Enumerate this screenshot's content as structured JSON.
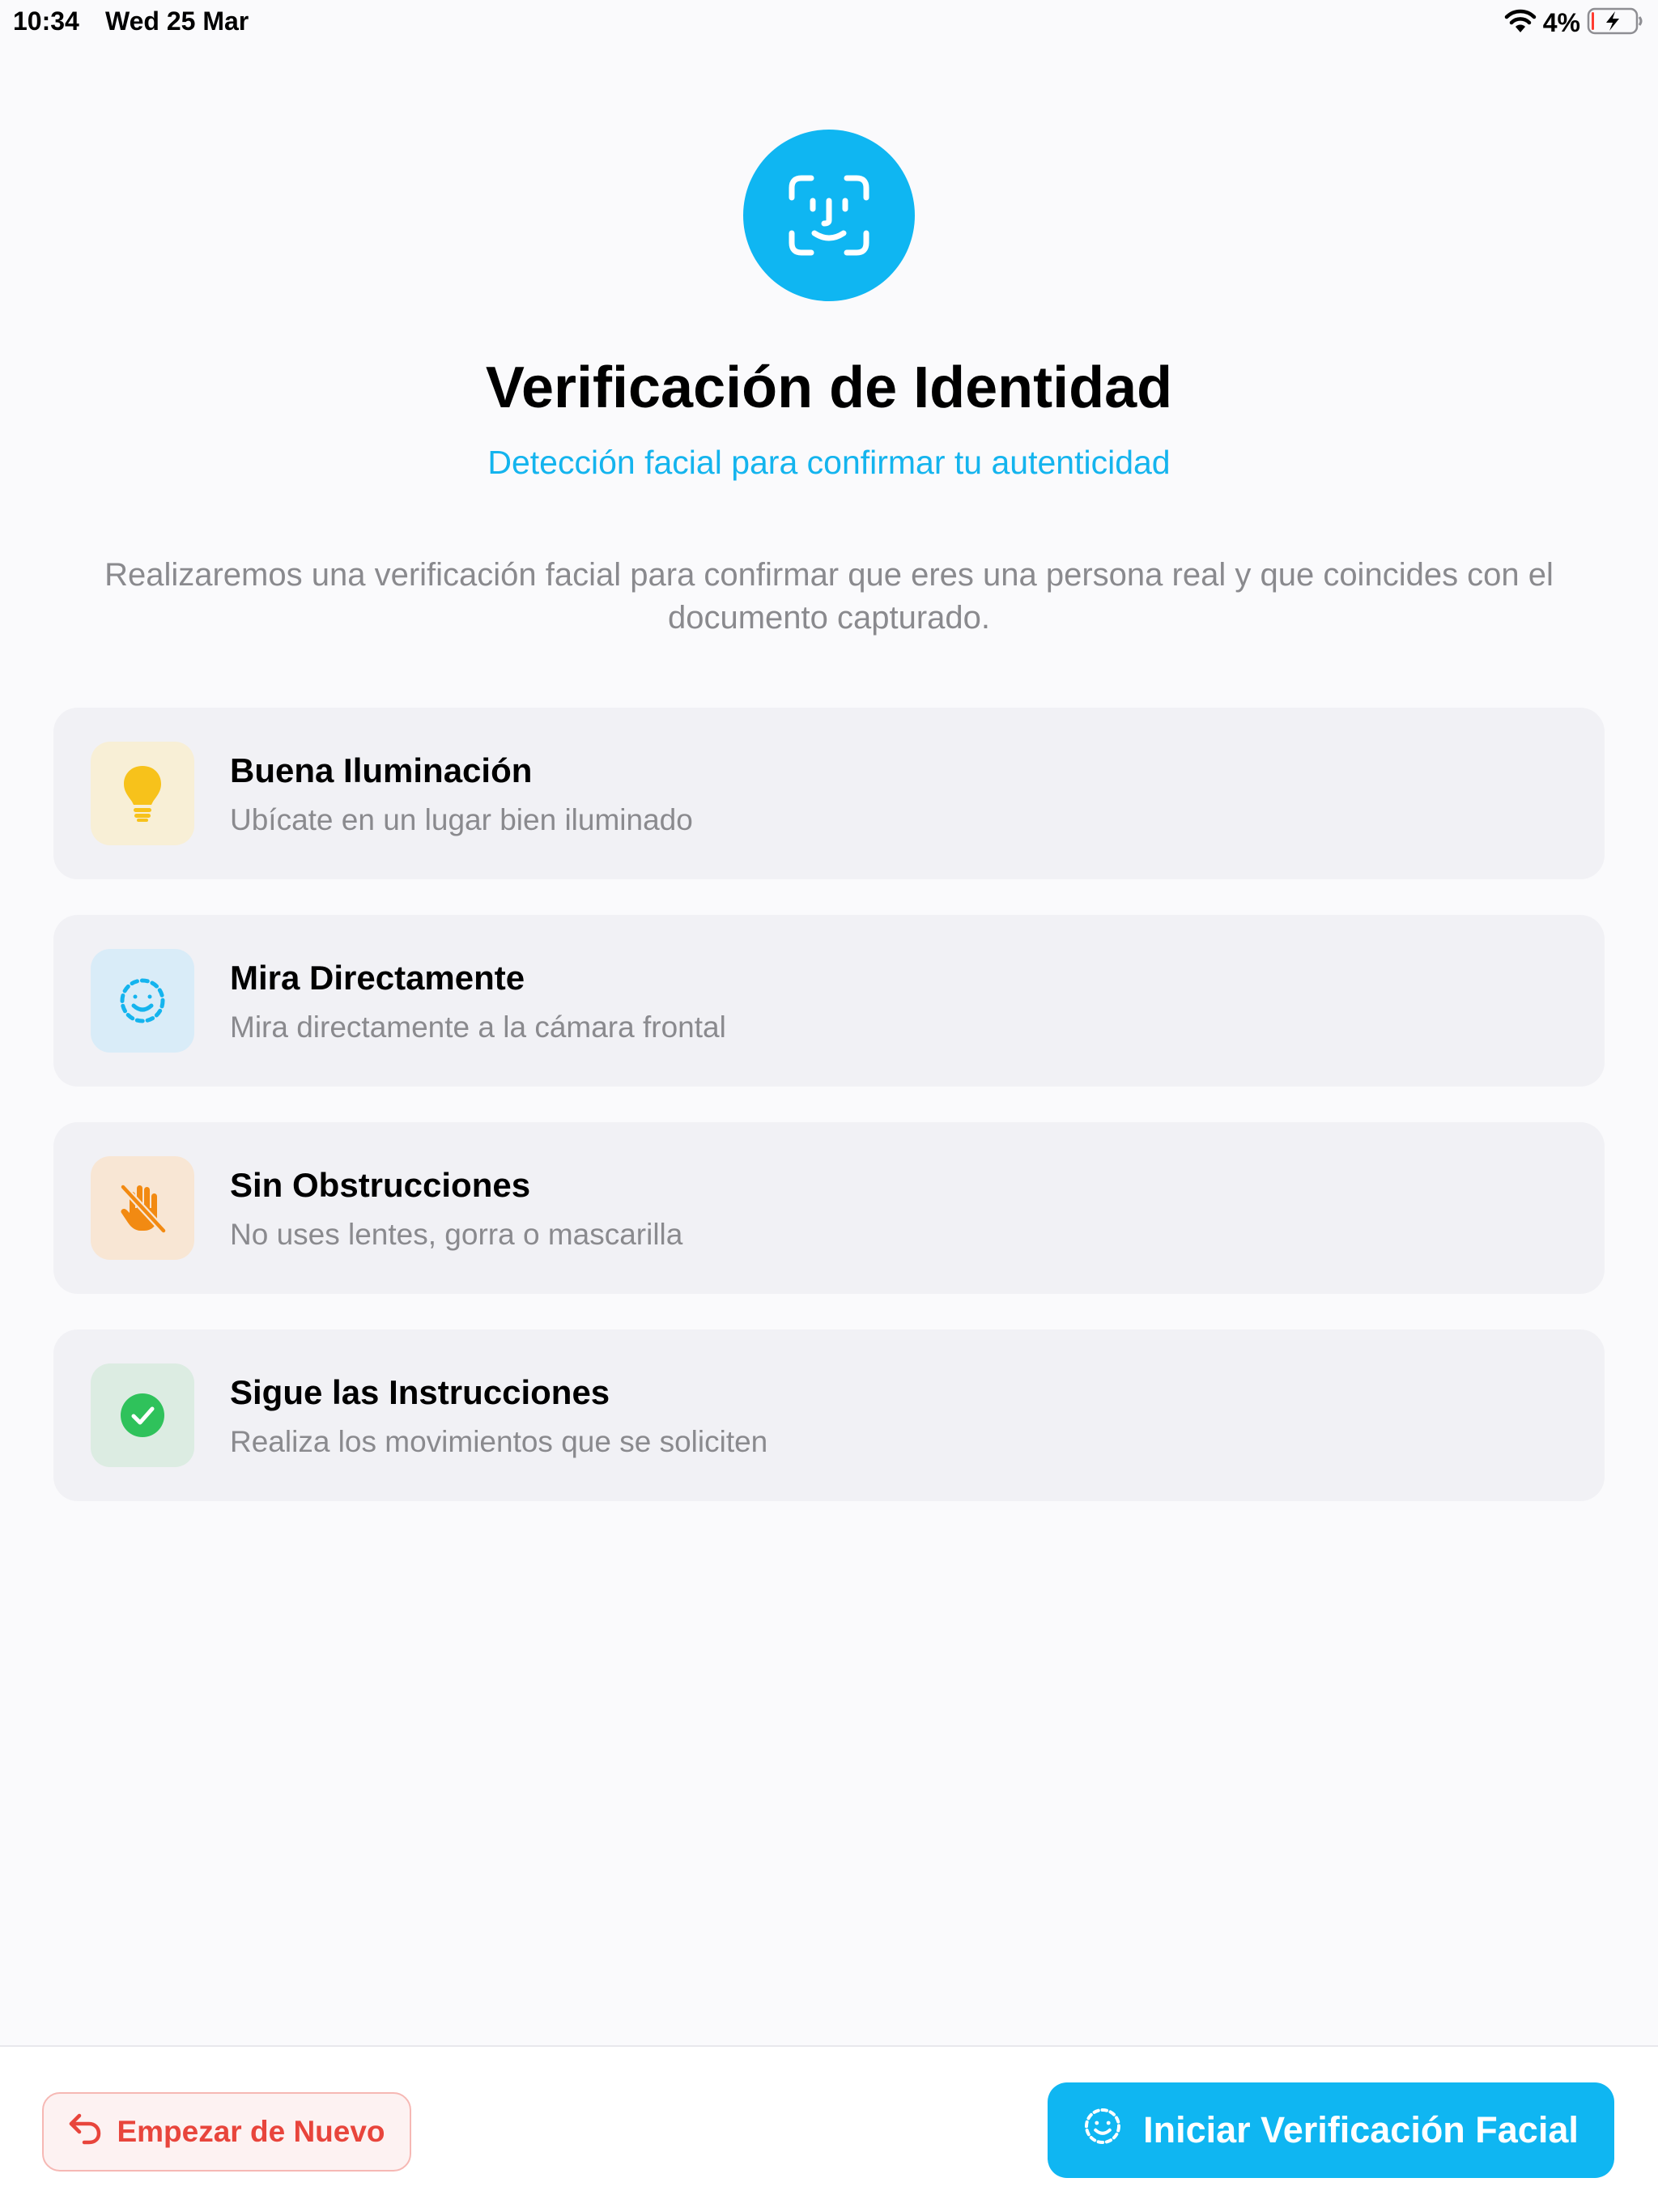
{
  "status_bar": {
    "time": "10:34",
    "date": "Wed 25 Mar",
    "battery_percent": "4%",
    "battery_level": 0.04,
    "charging": true
  },
  "header": {
    "icon": "face-id-icon",
    "title": "Verificación de Identidad",
    "subtitle": "Detección facial para confirmar tu autenticidad"
  },
  "description": "Realizaremos una verificación facial para confirmar que eres una persona real y que coincides con el documento capturado.",
  "tips": [
    {
      "icon": "lightbulb-icon",
      "title": "Buena Iluminación",
      "description": "Ubícate en un lugar bien iluminado",
      "accent": "#f7c21b"
    },
    {
      "icon": "face-dashed-icon",
      "title": "Mira Directamente",
      "description": "Mira directamente a la cámara frontal",
      "accent": "#14b4ee"
    },
    {
      "icon": "hand-slash-icon",
      "title": "Sin Obstrucciones",
      "description": "No uses lentes, gorra o mascarilla",
      "accent": "#f28a12"
    },
    {
      "icon": "checkmark-circle-icon",
      "title": "Sigue las Instrucciones",
      "description": "Realiza los movimientos que se soliciten",
      "accent": "#2fc25b"
    }
  ],
  "actions": {
    "restart_label": "Empezar de Nuevo",
    "restart_icon": "undo-arrow-icon",
    "start_label": "Iniciar Verificación Facial",
    "start_icon": "face-dashed-icon"
  },
  "colors": {
    "primary": "#0fb6f2",
    "danger": "#e8453c",
    "background": "#fafafc",
    "card": "#f1f1f5"
  }
}
